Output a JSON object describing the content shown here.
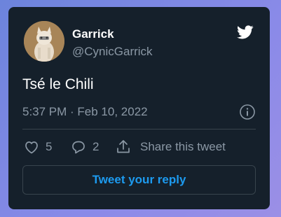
{
  "user": {
    "name": "Garrick",
    "handle": "@CynicGarrick",
    "avatar": "cat-avatar"
  },
  "tweet": {
    "text": "Tsé le Chili",
    "timestamp": "5:37 PM · Feb 10, 2022"
  },
  "actions": {
    "likes": "5",
    "replies": "2",
    "share_label": "Share this tweet"
  },
  "reply_button": "Tweet your reply",
  "icons": {
    "logo": "twitter-bird-icon",
    "info": "info-icon",
    "like": "heart-icon",
    "reply": "reply-bubble-icon",
    "share": "share-upload-icon"
  },
  "colors": {
    "card_bg": "#15202b",
    "text_primary": "#ffffff",
    "text_secondary": "#8b98a5",
    "accent": "#1d9bf0",
    "border": "#38444d"
  }
}
